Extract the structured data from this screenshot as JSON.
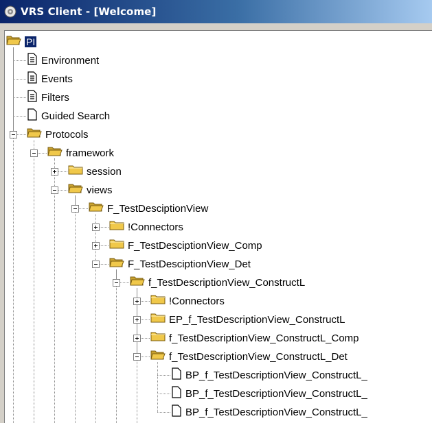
{
  "window": {
    "title": "VRS Client - [Welcome]"
  },
  "tree": {
    "nodes": [
      {
        "label": "PI",
        "icon": "folder-open-icon",
        "level": 0,
        "expander": "none",
        "selected": true
      },
      {
        "label": "Environment",
        "icon": "document-icon",
        "level": 1,
        "expander": "none"
      },
      {
        "label": "Events",
        "icon": "document-icon",
        "level": 1,
        "expander": "none"
      },
      {
        "label": "Filters",
        "icon": "document-icon",
        "level": 1,
        "expander": "none"
      },
      {
        "label": "Guided Search",
        "icon": "blank-page-icon",
        "level": 1,
        "expander": "none"
      },
      {
        "label": "Protocols",
        "icon": "folder-open-icon",
        "level": 1,
        "expander": "minus"
      },
      {
        "label": "framework",
        "icon": "folder-open-icon",
        "level": 2,
        "expander": "minus"
      },
      {
        "label": "session",
        "icon": "folder-icon",
        "level": 3,
        "expander": "plus"
      },
      {
        "label": "views",
        "icon": "folder-open-icon",
        "level": 3,
        "expander": "minus"
      },
      {
        "label": "F_TestDesciptionView",
        "icon": "folder-open-icon",
        "level": 4,
        "expander": "minus"
      },
      {
        "label": "!Connectors",
        "icon": "folder-icon",
        "level": 5,
        "expander": "plus"
      },
      {
        "label": "F_TestDesciptionView_Comp",
        "icon": "folder-icon",
        "level": 5,
        "expander": "plus"
      },
      {
        "label": "F_TestDesciptionView_Det",
        "icon": "folder-open-icon",
        "level": 5,
        "expander": "minus"
      },
      {
        "label": "f_TestDescriptionView_ConstructL",
        "icon": "folder-open-icon",
        "level": 6,
        "expander": "minus"
      },
      {
        "label": "!Connectors",
        "icon": "folder-icon",
        "level": 7,
        "expander": "plus"
      },
      {
        "label": "EP_f_TestDescriptionView_ConstructL",
        "icon": "folder-icon",
        "level": 7,
        "expander": "plus"
      },
      {
        "label": "f_TestDescriptionView_ConstructL_Comp",
        "icon": "folder-icon",
        "level": 7,
        "expander": "plus"
      },
      {
        "label": "f_TestDescriptionView_ConstructL_Det",
        "icon": "folder-open-icon",
        "level": 7,
        "expander": "minus"
      },
      {
        "label": "BP_f_TestDescriptionView_ConstructL_",
        "icon": "blank-page-icon",
        "level": 8,
        "expander": "none"
      },
      {
        "label": "BP_f_TestDescriptionView_ConstructL_",
        "icon": "blank-page-icon",
        "level": 8,
        "expander": "none"
      },
      {
        "label": "BP_f_TestDescriptionView_ConstructL_",
        "icon": "blank-page-icon",
        "level": 8,
        "expander": "none"
      }
    ]
  },
  "colors": {
    "title_start": "#0a246a",
    "title_end": "#a6caf0",
    "folder": "#f0c84a",
    "selection": "#0a246a"
  }
}
